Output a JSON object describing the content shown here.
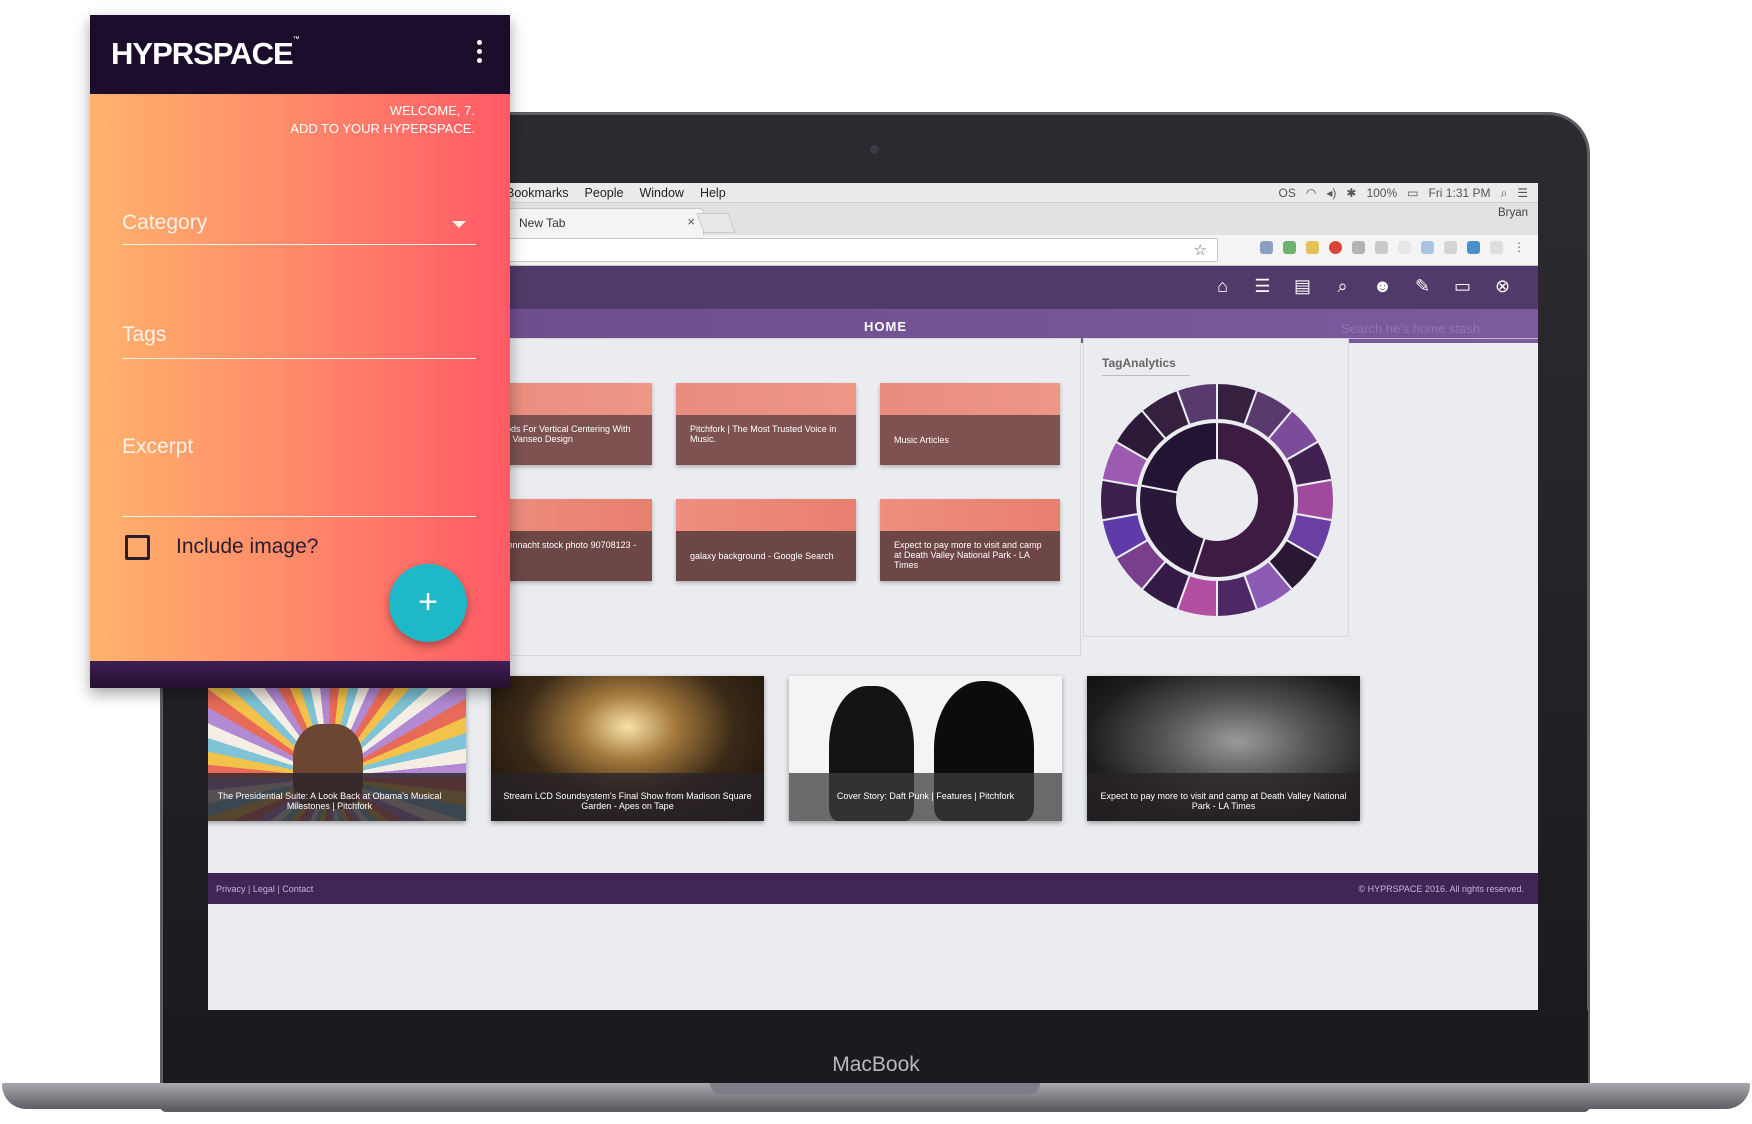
{
  "phone": {
    "logo": "HYPRSPACE",
    "logo_tm": "™",
    "welcome_line1": "WELCOME, 7.",
    "welcome_line2": "ADD TO YOUR HYPERSPACE.",
    "category_placeholder": "Category",
    "tags_placeholder": "Tags",
    "excerpt_placeholder": "Excerpt",
    "include_image_label": "Include image?",
    "include_image_checked": false,
    "fab_icon": "plus-icon"
  },
  "menubar": {
    "items": [
      "Bookmarks",
      "People",
      "Window",
      "Help"
    ],
    "status": {
      "battery": "100%",
      "time": "Fri 1:31 PM",
      "os_label": "OS"
    }
  },
  "browser": {
    "tab_title": "New Tab",
    "user": "Bryan"
  },
  "app": {
    "nav_icons": [
      "home-icon",
      "list-icon",
      "new-document-icon",
      "search-icon",
      "people-icon",
      "wrench-icon",
      "gamepad-icon",
      "close-icon"
    ],
    "nav_title": "HOME",
    "search_placeholder": "Search he's home stash",
    "cards": [
      "Methods For Vertical Centering With CSS - Vanseo Design",
      "Pitchfork | The Most Trusted Voice in Music.",
      "Music Articles",
      "Sternennacht stock photo 90708123 - iStock",
      "galaxy background - Google Search",
      "Expect to pay more to visit and camp at Death Valley National Park - LA Times"
    ],
    "tag_analytics_title": "TagAnalytics",
    "photos": [
      "The Presidential Suite: A Look Back at Obama's Musical Milestones | Pitchfork",
      "Stream LCD Soundsystem's Final Show from Madison Square Garden - Apes on Tape",
      "Cover Story: Daft Punk | Features | Pitchfork",
      "Expect to pay more to visit and camp at Death Valley National Park - LA Times"
    ],
    "footer_left": "Privacy | Legal | Contact",
    "footer_right": "© HYPRSPACE 2016. All rights reserved."
  },
  "laptop": {
    "label": "MacBook"
  },
  "colors": {
    "app_header": "#4f3a69",
    "footer": "#412557",
    "fab": "#1eb8c9",
    "phone_header": "#1c0d2c"
  }
}
